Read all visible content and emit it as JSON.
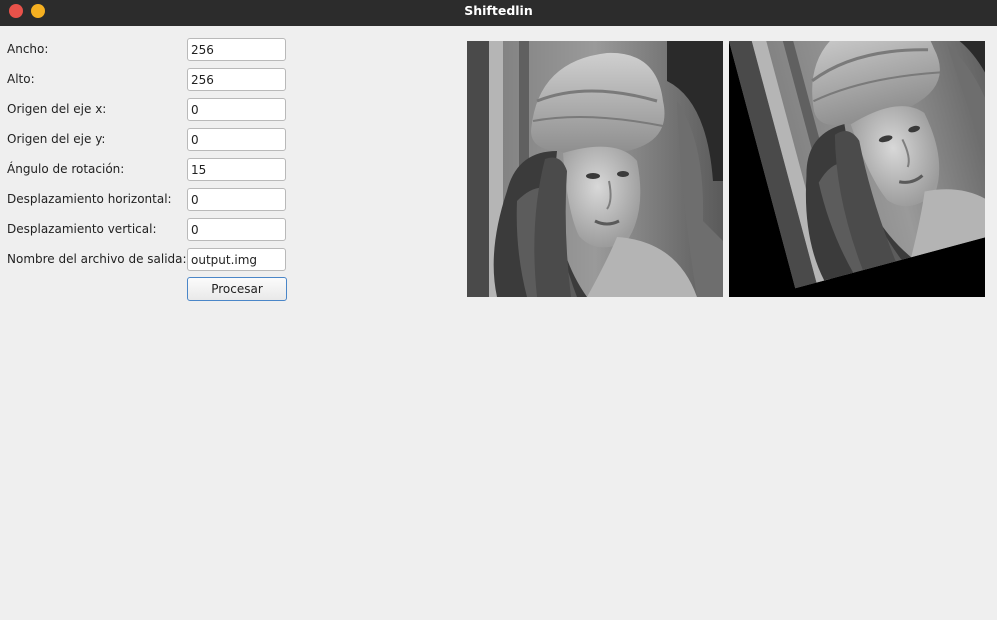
{
  "window": {
    "title": "Shiftedlin",
    "buttons": [
      "close",
      "minimize"
    ]
  },
  "form": {
    "fields": [
      {
        "label": "Ancho:",
        "value": "256"
      },
      {
        "label": "Alto:",
        "value": "256"
      },
      {
        "label": "Origen del eje x:",
        "value": "0"
      },
      {
        "label": "Origen del eje y:",
        "value": "0"
      },
      {
        "label": "Ángulo de rotación:",
        "value": "15"
      },
      {
        "label": "Desplazamiento horizontal:",
        "value": "0"
      },
      {
        "label": "Desplazamiento vertical:",
        "value": "0"
      },
      {
        "label": "Nombre del archivo de salida:",
        "value": "output.img"
      }
    ],
    "process_button": "Procesar"
  },
  "images": {
    "original": {
      "subject": "grayscale portrait photo (Lena)"
    },
    "rotated": {
      "subject": "same photo rotated 15°, black corners filled",
      "rotation_deg": 15
    }
  },
  "colors": {
    "titlebar": "#2c2c2c",
    "close_button": "#e9524a",
    "minimize_button": "#f5b021",
    "window_bg": "#efefef"
  }
}
